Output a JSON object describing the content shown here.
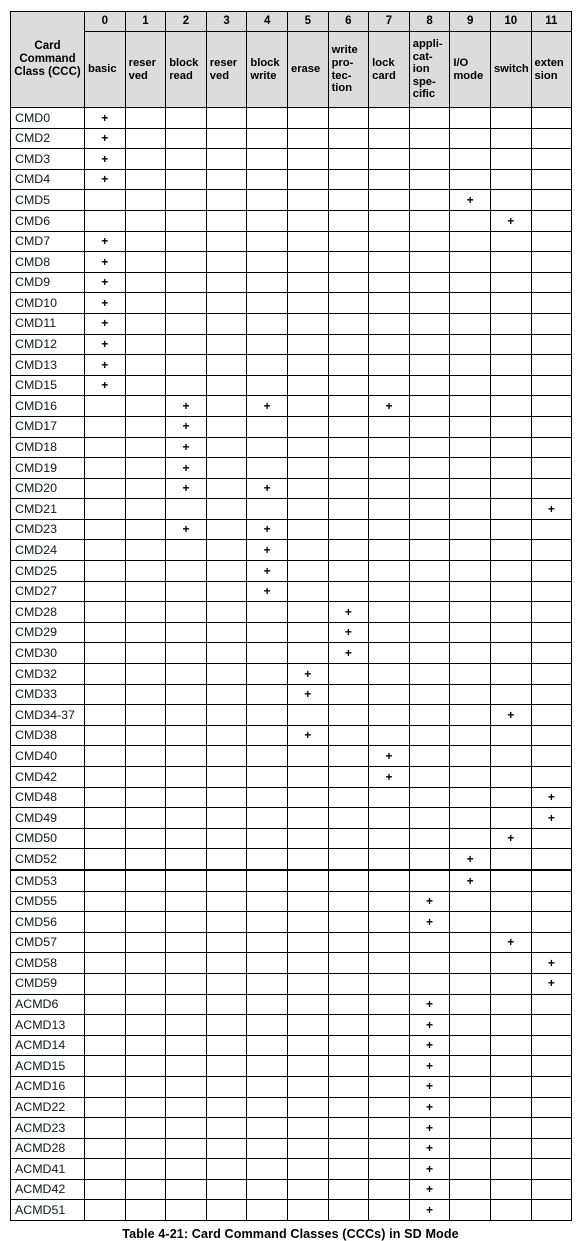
{
  "table": {
    "corner_label": "Card Command Class (CCC)",
    "class_numbers": [
      "0",
      "1",
      "2",
      "3",
      "4",
      "5",
      "6",
      "7",
      "8",
      "9",
      "10",
      "11"
    ],
    "class_names": [
      "basic",
      "reser ved",
      "block read",
      "reser ved",
      "block write",
      "erase",
      "write pro- tec- tion",
      "lock card",
      "appli- cat- ion spe- cific",
      "I/O mode",
      "switch",
      "exten sion"
    ],
    "mark_symbol": "+",
    "header_bg": "#dcdcdc",
    "border_color": "#000000",
    "rows": [
      {
        "label": "CMD0",
        "marks": [
          0
        ]
      },
      {
        "label": "CMD2",
        "marks": [
          0
        ]
      },
      {
        "label": "CMD3",
        "marks": [
          0
        ]
      },
      {
        "label": "CMD4",
        "marks": [
          0
        ]
      },
      {
        "label": "CMD5",
        "marks": [
          9
        ]
      },
      {
        "label": "CMD6",
        "marks": [
          10
        ]
      },
      {
        "label": "CMD7",
        "marks": [
          0
        ]
      },
      {
        "label": "CMD8",
        "marks": [
          0
        ]
      },
      {
        "label": "CMD9",
        "marks": [
          0
        ]
      },
      {
        "label": "CMD10",
        "marks": [
          0
        ]
      },
      {
        "label": "CMD11",
        "marks": [
          0
        ]
      },
      {
        "label": "CMD12",
        "marks": [
          0
        ]
      },
      {
        "label": "CMD13",
        "marks": [
          0
        ]
      },
      {
        "label": "CMD15",
        "marks": [
          0
        ]
      },
      {
        "label": "CMD16",
        "marks": [
          2,
          4,
          7
        ]
      },
      {
        "label": "CMD17",
        "marks": [
          2
        ]
      },
      {
        "label": "CMD18",
        "marks": [
          2
        ]
      },
      {
        "label": "CMD19",
        "marks": [
          2
        ]
      },
      {
        "label": "CMD20",
        "marks": [
          2,
          4
        ]
      },
      {
        "label": "CMD21",
        "marks": [
          11
        ]
      },
      {
        "label": "CMD23",
        "marks": [
          2,
          4
        ]
      },
      {
        "label": "CMD24",
        "marks": [
          4
        ]
      },
      {
        "label": "CMD25",
        "marks": [
          4
        ]
      },
      {
        "label": "CMD27",
        "marks": [
          4
        ]
      },
      {
        "label": "CMD28",
        "marks": [
          6
        ]
      },
      {
        "label": "CMD29",
        "marks": [
          6
        ]
      },
      {
        "label": "CMD30",
        "marks": [
          6
        ]
      },
      {
        "label": "CMD32",
        "marks": [
          5
        ]
      },
      {
        "label": "CMD33",
        "marks": [
          5
        ]
      },
      {
        "label": "CMD34-37",
        "marks": [
          10
        ]
      },
      {
        "label": "CMD38",
        "marks": [
          5
        ]
      },
      {
        "label": "CMD40",
        "marks": [
          7
        ]
      },
      {
        "label": "CMD42",
        "marks": [
          7
        ]
      },
      {
        "label": "CMD48",
        "marks": [
          11
        ]
      },
      {
        "label": "CMD49",
        "marks": [
          11
        ]
      },
      {
        "label": "CMD50",
        "marks": [
          10
        ]
      },
      {
        "label": "CMD52",
        "marks": [
          9
        ],
        "thick_bottom": true
      },
      {
        "label": "CMD53",
        "marks": [
          9
        ]
      },
      {
        "label": "CMD55",
        "marks": [
          8
        ]
      },
      {
        "label": "CMD56",
        "marks": [
          8
        ]
      },
      {
        "label": "CMD57",
        "marks": [
          10
        ]
      },
      {
        "label": "CMD58",
        "marks": [
          11
        ]
      },
      {
        "label": "CMD59",
        "marks": [
          11
        ]
      },
      {
        "label": "ACMD6",
        "marks": [
          8
        ]
      },
      {
        "label": "ACMD13",
        "marks": [
          8
        ]
      },
      {
        "label": "ACMD14",
        "marks": [
          8
        ]
      },
      {
        "label": "ACMD15",
        "marks": [
          8
        ]
      },
      {
        "label": "ACMD16",
        "marks": [
          8
        ]
      },
      {
        "label": "ACMD22",
        "marks": [
          8
        ]
      },
      {
        "label": "ACMD23",
        "marks": [
          8
        ]
      },
      {
        "label": "ACMD28",
        "marks": [
          8
        ]
      },
      {
        "label": "ACMD41",
        "marks": [
          8
        ]
      },
      {
        "label": "ACMD42",
        "marks": [
          8
        ]
      },
      {
        "label": "ACMD51",
        "marks": [
          8
        ]
      }
    ]
  },
  "caption": "Table 4-21: Card Command Classes (CCCs) in SD Mode"
}
